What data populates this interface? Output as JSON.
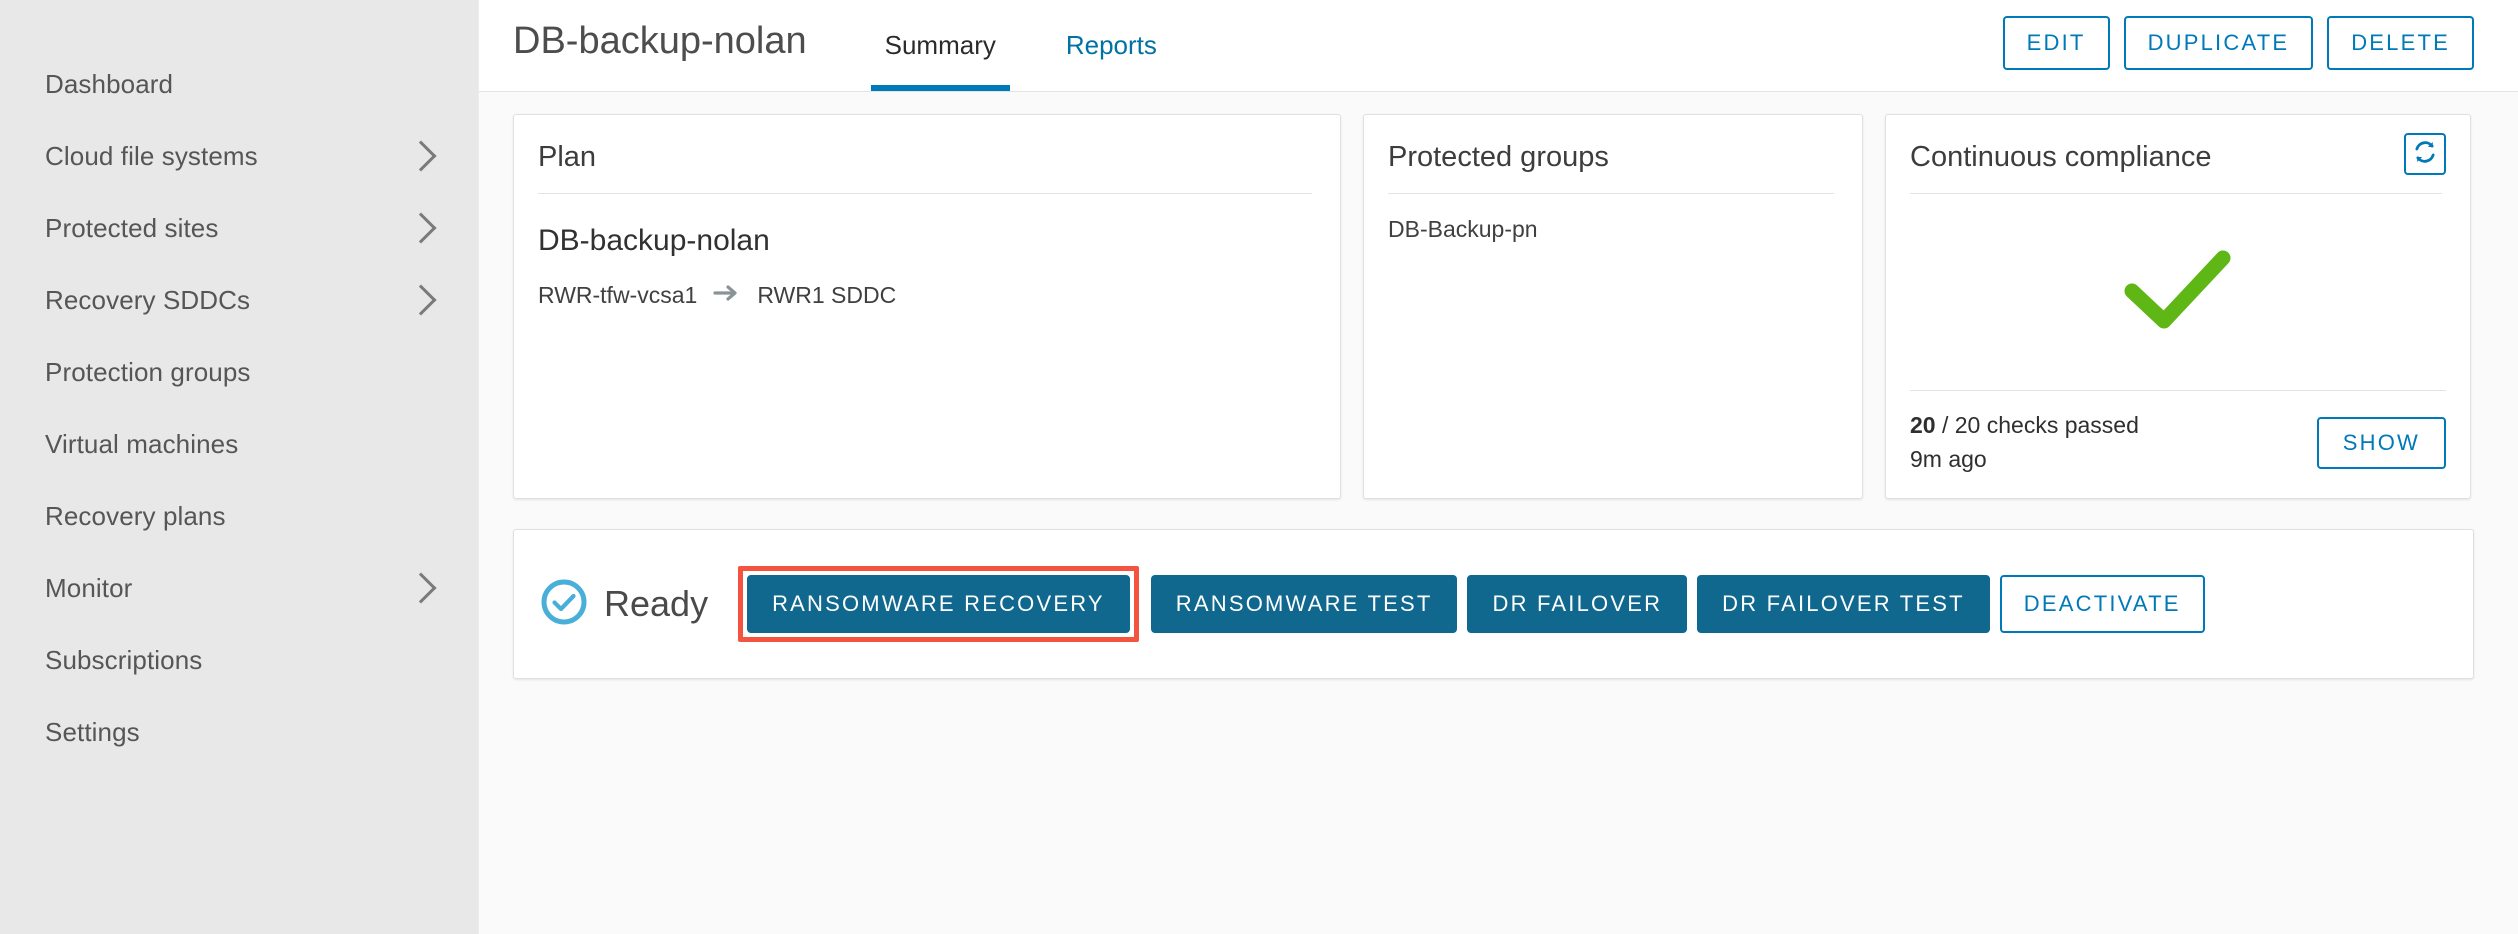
{
  "sidebar": {
    "items": [
      {
        "label": "Dashboard",
        "expandable": false,
        "icon": ""
      },
      {
        "label": "Cloud file systems",
        "expandable": true,
        "icon": "chevron-right-icon"
      },
      {
        "label": "Protected sites",
        "expandable": true,
        "icon": "chevron-right-icon"
      },
      {
        "label": "Recovery SDDCs",
        "expandable": true,
        "icon": "chevron-right-icon"
      },
      {
        "label": "Protection groups",
        "expandable": false,
        "icon": ""
      },
      {
        "label": "Virtual machines",
        "expandable": false,
        "icon": ""
      },
      {
        "label": "Recovery plans",
        "expandable": false,
        "icon": ""
      },
      {
        "label": "Monitor",
        "expandable": true,
        "icon": "chevron-right-icon"
      },
      {
        "label": "Subscriptions",
        "expandable": false,
        "icon": ""
      },
      {
        "label": "Settings",
        "expandable": false,
        "icon": ""
      }
    ]
  },
  "header": {
    "title": "DB-backup-nolan",
    "tabs": [
      {
        "label": "Summary",
        "active": true
      },
      {
        "label": "Reports",
        "active": false
      }
    ],
    "actions": [
      {
        "label": "EDIT"
      },
      {
        "label": "DUPLICATE"
      },
      {
        "label": "DELETE"
      }
    ]
  },
  "cards": {
    "plan": {
      "title": "Plan",
      "name": "DB-backup-nolan",
      "source": "RWR-tfw-vcsa1",
      "arrow_icon": "arrow-right-icon",
      "target": "RWR1 SDDC"
    },
    "protected_groups": {
      "title": "Protected groups",
      "groups": [
        "DB-Backup-pn"
      ]
    },
    "compliance": {
      "title": "Continuous compliance",
      "refresh_icon": "refresh-icon",
      "state_icon": "green-check-icon",
      "checks_passed_count": "20",
      "checks_passed_text": " / 20 checks passed",
      "last_run": "9m ago",
      "show_label": "SHOW"
    }
  },
  "action_bar": {
    "status_icon": "check-circle-icon",
    "status_label": "Ready",
    "buttons": [
      {
        "label": "RANSOMWARE RECOVERY",
        "style": "primary",
        "highlighted": true
      },
      {
        "label": "RANSOMWARE TEST",
        "style": "primary",
        "highlighted": false
      },
      {
        "label": "DR FAILOVER",
        "style": "primary",
        "highlighted": false
      },
      {
        "label": "DR FAILOVER TEST",
        "style": "primary",
        "highlighted": false
      },
      {
        "label": "DEACTIVATE",
        "style": "outline",
        "highlighted": false
      }
    ]
  },
  "colors": {
    "accent_blue": "#0079b8",
    "primary_button": "#10688f",
    "status_blue": "#49afd9",
    "success_green": "#5eb715",
    "highlight_red": "#f4533f",
    "sidebar_bg": "#e8e8e8",
    "content_bg": "#fafafa"
  }
}
